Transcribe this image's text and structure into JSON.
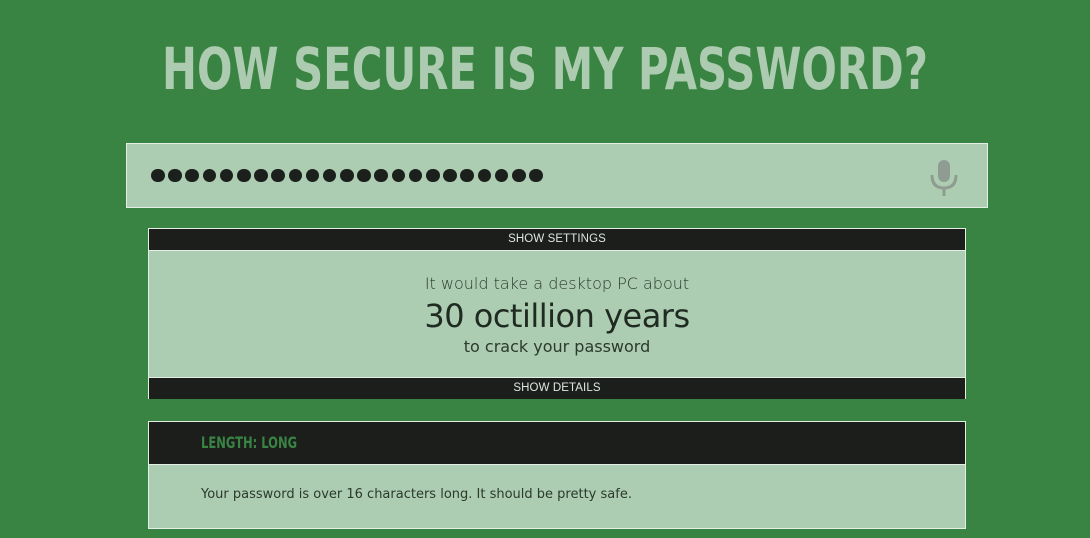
{
  "page": {
    "title": "HOW SECURE IS MY PASSWORD?"
  },
  "password_field": {
    "masked_length": 23,
    "mic_icon": "microphone-icon"
  },
  "settings_toggle": {
    "label": "SHOW SETTINGS"
  },
  "result": {
    "line1": "It would take a desktop PC about",
    "time": "30 octillion years",
    "line3": "to crack your password"
  },
  "details_toggle": {
    "label": "SHOW DETAILS"
  },
  "check": {
    "title": "LENGTH: LONG",
    "description": "Your password is over 16 characters long. It should be pretty safe."
  },
  "colors": {
    "background": "#3a8443",
    "panel": "#adcdb2",
    "bar": "#1b1e1b",
    "accent": "#3a8443",
    "title": "#adcbb0"
  }
}
